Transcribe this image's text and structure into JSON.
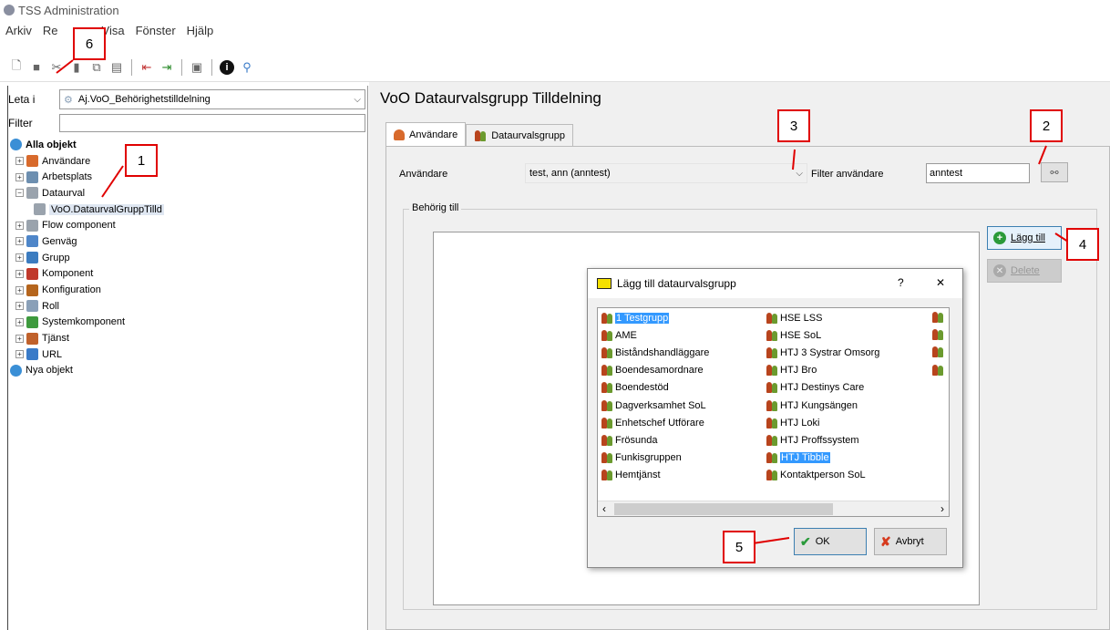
{
  "window": {
    "title": "TSS Administration"
  },
  "menu": [
    "Arkiv",
    "Re",
    "Visa",
    "Fönster",
    "Hjälp"
  ],
  "toolbar": {
    "icons": [
      "new-icon",
      "save-icon",
      "cut-icon",
      "paste-icon",
      "copy-icon",
      "paste2-icon",
      "move-left-icon",
      "move-right-icon",
      "properties-icon",
      "info-icon",
      "help-icon"
    ]
  },
  "leftpane": {
    "search_label": "Leta i",
    "search_value": "Aj.VoO_Behörighetstilldelning",
    "filter_label": "Filter",
    "filter_value": "",
    "tree": [
      {
        "label": "Alla objekt",
        "bold": true,
        "level": 0,
        "expander": "",
        "icon": "#3a8fd6"
      },
      {
        "label": "Användare",
        "level": 1,
        "expander": "+",
        "icon": "#d86a2c"
      },
      {
        "label": "Arbetsplats",
        "level": 1,
        "expander": "+",
        "icon": "#6d8fb0"
      },
      {
        "label": "Dataurval",
        "level": 1,
        "expander": "−",
        "icon": "#9aa3ad"
      },
      {
        "label": "VoO.DataurvalGruppTilld",
        "level": 2,
        "expander": "",
        "icon": "#9aa3ad",
        "selected": true
      },
      {
        "label": "Flow component",
        "level": 1,
        "expander": "+",
        "icon": "#9aa3ad"
      },
      {
        "label": "Genväg",
        "level": 1,
        "expander": "+",
        "icon": "#4e86c9"
      },
      {
        "label": "Grupp",
        "level": 1,
        "expander": "+",
        "icon": "#3c7cc0"
      },
      {
        "label": "Komponent",
        "level": 1,
        "expander": "+",
        "icon": "#c0392b"
      },
      {
        "label": "Konfiguration",
        "level": 1,
        "expander": "+",
        "icon": "#b5651d"
      },
      {
        "label": "Roll",
        "level": 1,
        "expander": "+",
        "icon": "#8aa0b8"
      },
      {
        "label": "Systemkomponent",
        "level": 1,
        "expander": "+",
        "icon": "#3e9a3e"
      },
      {
        "label": "Tjänst",
        "level": 1,
        "expander": "+",
        "icon": "#c0612b"
      },
      {
        "label": "URL",
        "level": 1,
        "expander": "+",
        "icon": "#3a7bc8"
      },
      {
        "label": "Nya objekt",
        "level": 0,
        "expander": "",
        "icon": "#3a8fd6"
      }
    ]
  },
  "main": {
    "title": "VoO Dataurvalsgrupp Tilldelning",
    "tabs": [
      "Användare",
      "Dataurvalsgrupp"
    ],
    "user_label": "Användare",
    "user_value": "test, ann (anntest)",
    "filter_label": "Filter användare",
    "filter_value": "anntest",
    "group_label": "Behörig till",
    "add_button": "Lägg till",
    "delete_button": "Delete"
  },
  "dialog": {
    "title": "Lägg till dataurvalsgrupp",
    "help": "?",
    "close": "✕",
    "col1": [
      "1 Testgrupp",
      "AME",
      "Biståndshandläggare",
      "Boendesamordnare",
      "Boendestöd",
      "Dagverksamhet SoL",
      "Enhetschef Utförare",
      "Frösunda",
      "Funkisgruppen",
      "Hemtjänst"
    ],
    "col2": [
      "HSE LSS",
      "HSE SoL",
      "HTJ 3 Systrar Omsorg",
      "HTJ Bro",
      "HTJ Destinys Care",
      "HTJ Kungsängen",
      "HTJ Loki",
      "HTJ Proffssystem",
      "HTJ Tibble",
      "Kontaktperson SoL"
    ],
    "ok_button": "OK",
    "cancel_button": "Avbryt"
  },
  "callouts": [
    "1",
    "2",
    "3",
    "4",
    "5",
    "6"
  ],
  "colors": {
    "callout": "#e00000",
    "selection": "#3399ff"
  }
}
